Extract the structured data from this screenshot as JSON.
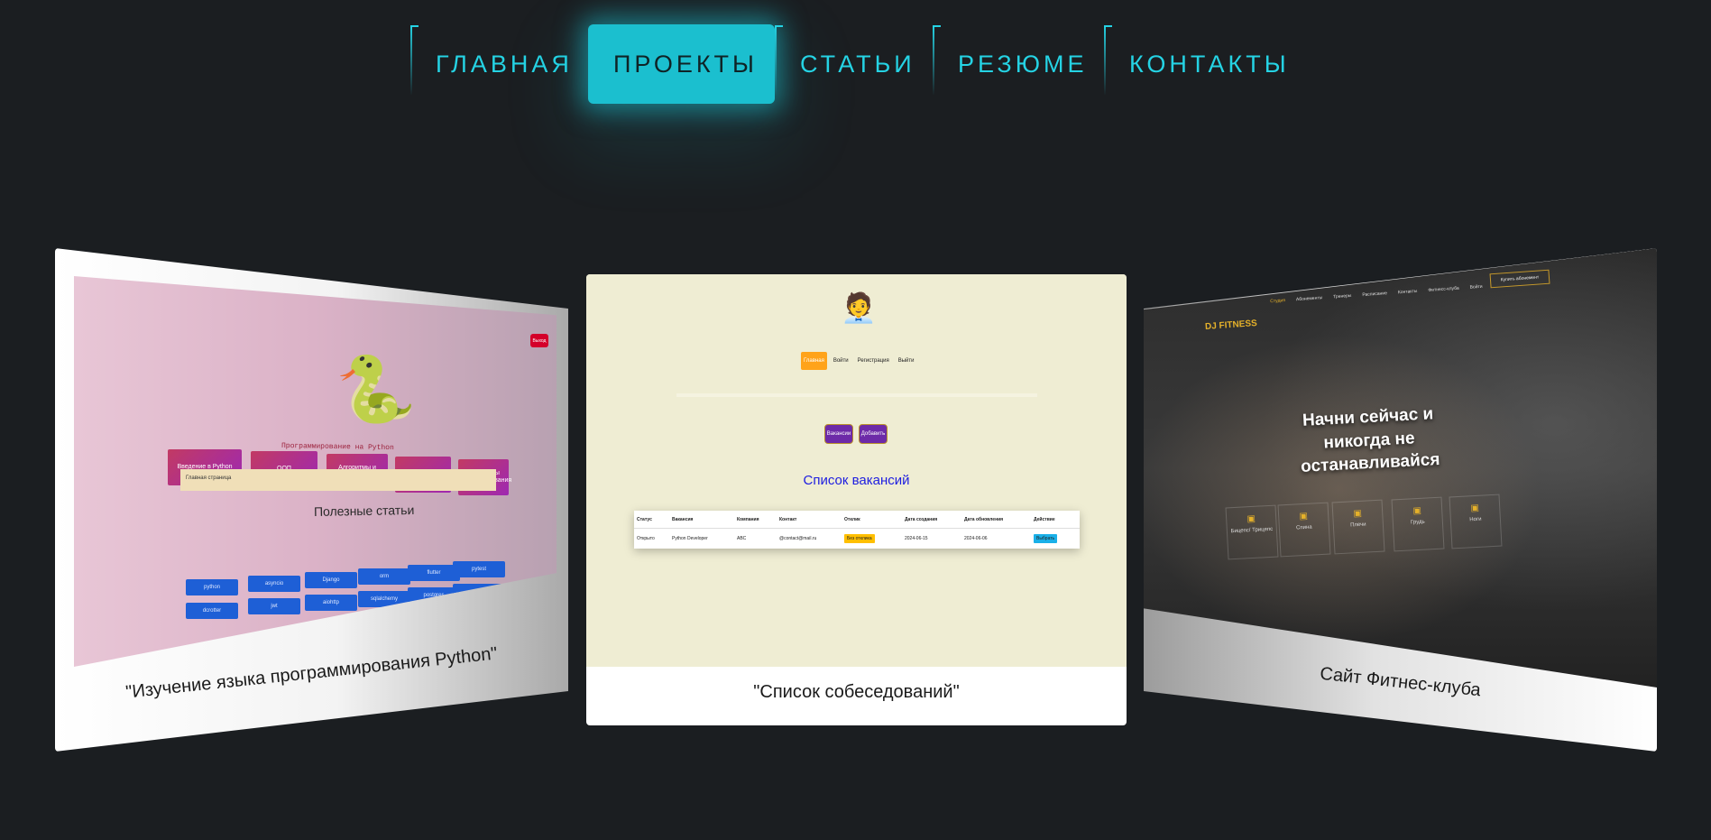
{
  "nav": {
    "items": [
      {
        "label": "ГЛАВНАЯ"
      },
      {
        "label": "ПРОЕКТЫ"
      },
      {
        "label": "СТАТЬИ"
      },
      {
        "label": "РЕЗЮМЕ"
      },
      {
        "label": "КОНТАКТЫ"
      }
    ],
    "active": "ПРОЕКТЫ",
    "accent_color": "#25d3e4",
    "active_bg": "#1bbfcf"
  },
  "projects": [
    {
      "caption": "\"Изучение языка программирования Python\"",
      "screenshot": {
        "title": "Программирование на Python",
        "logout": "Выход",
        "tiles": [
          "Введение в Python",
          "ООП",
          "Алгоритмы и Структуры данных",
          "Фреймворки",
          "Алгоритмы программирования"
        ],
        "breadcrumb": "Главная страница",
        "section_title": "Полезные статьи",
        "tags": [
          "python",
          "asyncio",
          "Django",
          "orm",
          "flutter",
          "pytest",
          "dcrotter",
          "jwt",
          "aiohttp",
          "sqlalchemy",
          "postgres",
          "celery"
        ]
      }
    },
    {
      "caption": "\"Список собеседований\"",
      "screenshot": {
        "nav": [
          "Главная",
          "Войти",
          "Регистрация",
          "Выйти"
        ],
        "buttons": [
          "Вакансии",
          "Добавить"
        ],
        "heading": "Список вакансий",
        "columns": [
          "Статус",
          "Вакансия",
          "Компания",
          "Контакт",
          "Отклик",
          "Дата создания",
          "Дата обновления",
          "Действие"
        ],
        "row": [
          "Открыто",
          "Python Developer",
          "ABC",
          "@contact@mail.ru",
          "Без отклика",
          "2024-06-15",
          "2024-06-06",
          "Выбрать"
        ]
      }
    },
    {
      "caption": "Сайт Фитнес-клуба",
      "screenshot": {
        "logo": "DJ FITNESS",
        "menu": [
          "Студия",
          "Абонементы",
          "Тренеры",
          "Расписание",
          "Контакты",
          "Фитнесс-клуба"
        ],
        "menu_extra": "Войти",
        "buy_button": "Купить абонемент",
        "hero": "Начни сейчас и никогда не останавливайся",
        "categories": [
          "Бицепс/ Трицепс",
          "Спина",
          "Плечи",
          "Грудь",
          "Ноги"
        ]
      }
    }
  ]
}
